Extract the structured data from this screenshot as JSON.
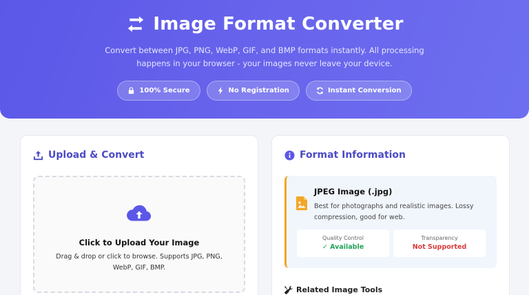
{
  "hero": {
    "title": "Image Format Converter",
    "icon": "exchange-arrows-icon",
    "description": "Convert between JPG, PNG, WebP, GIF, and BMP formats instantly. All processing happens in your browser - your images never leave your device.",
    "badges": [
      {
        "label": "100% Secure",
        "icon": "lock-icon"
      },
      {
        "label": "No Registration",
        "icon": "bolt-icon"
      },
      {
        "label": "Instant Conversion",
        "icon": "sync-icon"
      }
    ]
  },
  "upload": {
    "heading": "Upload & Convert",
    "icon": "upload-icon",
    "dropzone": {
      "title": "Click to Upload Your Image",
      "subtitle": "Drag & drop or click to browse. Supports JPG, PNG, WebP, GIF, BMP.",
      "icon": "cloud-upload-icon"
    }
  },
  "format_info": {
    "heading": "Format Information",
    "icon": "info-icon",
    "format_name": "JPEG Image (.jpg)",
    "format_icon": "image-file-icon",
    "description": "Best for photographs and realistic images. Lossy compression, good for web.",
    "stats": [
      {
        "label": "Quality Control",
        "value": "✓ Available",
        "status": "ok"
      },
      {
        "label": "Transparency",
        "value": "Not Supported",
        "status": "bad"
      }
    ],
    "related_heading": "Related Image Tools",
    "related_icon": "tools-icon"
  },
  "colors": {
    "primary": "#5b57e8",
    "heading": "#4c4bc6",
    "accent_border": "#f3a625",
    "success": "#22a35a",
    "danger": "#d93b3b"
  }
}
